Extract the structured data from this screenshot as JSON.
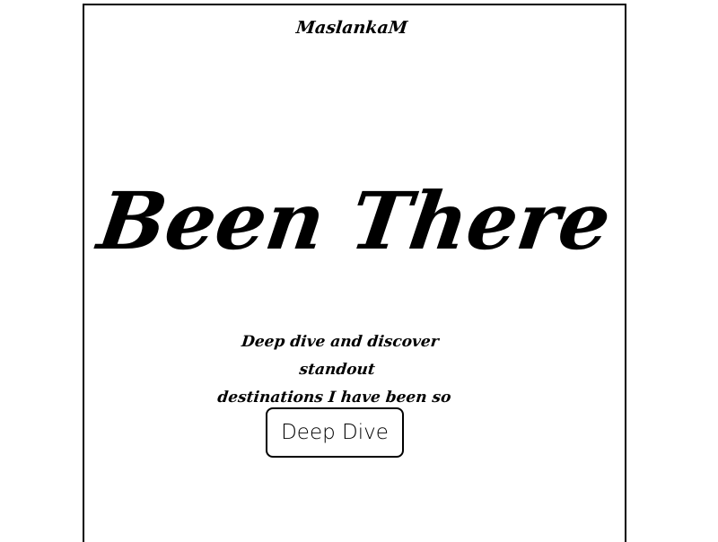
{
  "header": {
    "brand": "MaslankaM"
  },
  "hero": {
    "title": "Been There",
    "tagline_line1": "Deep dive and discover standout",
    "tagline_line2": "destinations I have been so far.",
    "cta_label": "Deep Dive"
  },
  "colors": {
    "background": "#ffffff",
    "text": "#000000",
    "border": "#000000"
  }
}
